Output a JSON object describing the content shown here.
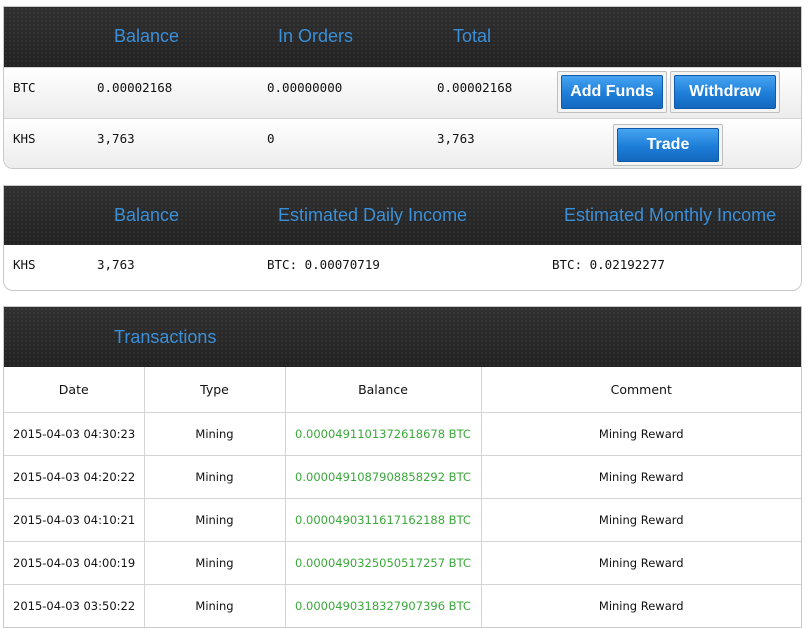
{
  "account": {
    "headers": {
      "balance": "Balance",
      "in_orders": "In Orders",
      "total": "Total"
    },
    "rows": [
      {
        "currency": "BTC",
        "balance": "0.00002168",
        "in_orders": "0.00000000",
        "total": "0.00002168"
      },
      {
        "currency": "KHS",
        "balance": "3,763",
        "in_orders": "0",
        "total": "3,763"
      }
    ],
    "buttons": {
      "add_funds": "Add Funds",
      "withdraw": "Withdraw",
      "trade": "Trade"
    }
  },
  "income": {
    "headers": {
      "balance": "Balance",
      "daily": "Estimated Daily Income",
      "monthly": "Estimated Monthly Income"
    },
    "row": {
      "currency": "KHS",
      "balance": "3,763",
      "daily": "BTC: 0.00070719",
      "monthly": "BTC: 0.02192277"
    }
  },
  "transactions": {
    "title": "Transactions",
    "columns": [
      "Date",
      "Type",
      "Balance",
      "Comment"
    ],
    "rows": [
      {
        "date": "2015-04-03 04:30:23",
        "type": "Mining",
        "balance": "0.0000491101372618678 BTC",
        "comment": "Mining Reward"
      },
      {
        "date": "2015-04-03 04:20:22",
        "type": "Mining",
        "balance": "0.0000491087908858292 BTC",
        "comment": "Mining Reward"
      },
      {
        "date": "2015-04-03 04:10:21",
        "type": "Mining",
        "balance": "0.0000490311617162188 BTC",
        "comment": "Mining Reward"
      },
      {
        "date": "2015-04-03 04:00:19",
        "type": "Mining",
        "balance": "0.0000490325050517257 BTC",
        "comment": "Mining Reward"
      },
      {
        "date": "2015-04-03 03:50:22",
        "type": "Mining",
        "balance": "0.0000490318327907396 BTC",
        "comment": "Mining Reward"
      }
    ]
  },
  "colors": {
    "header_text": "#3a8fd9",
    "button": "#1d7ed8",
    "positive_balance": "#3aa83a"
  }
}
